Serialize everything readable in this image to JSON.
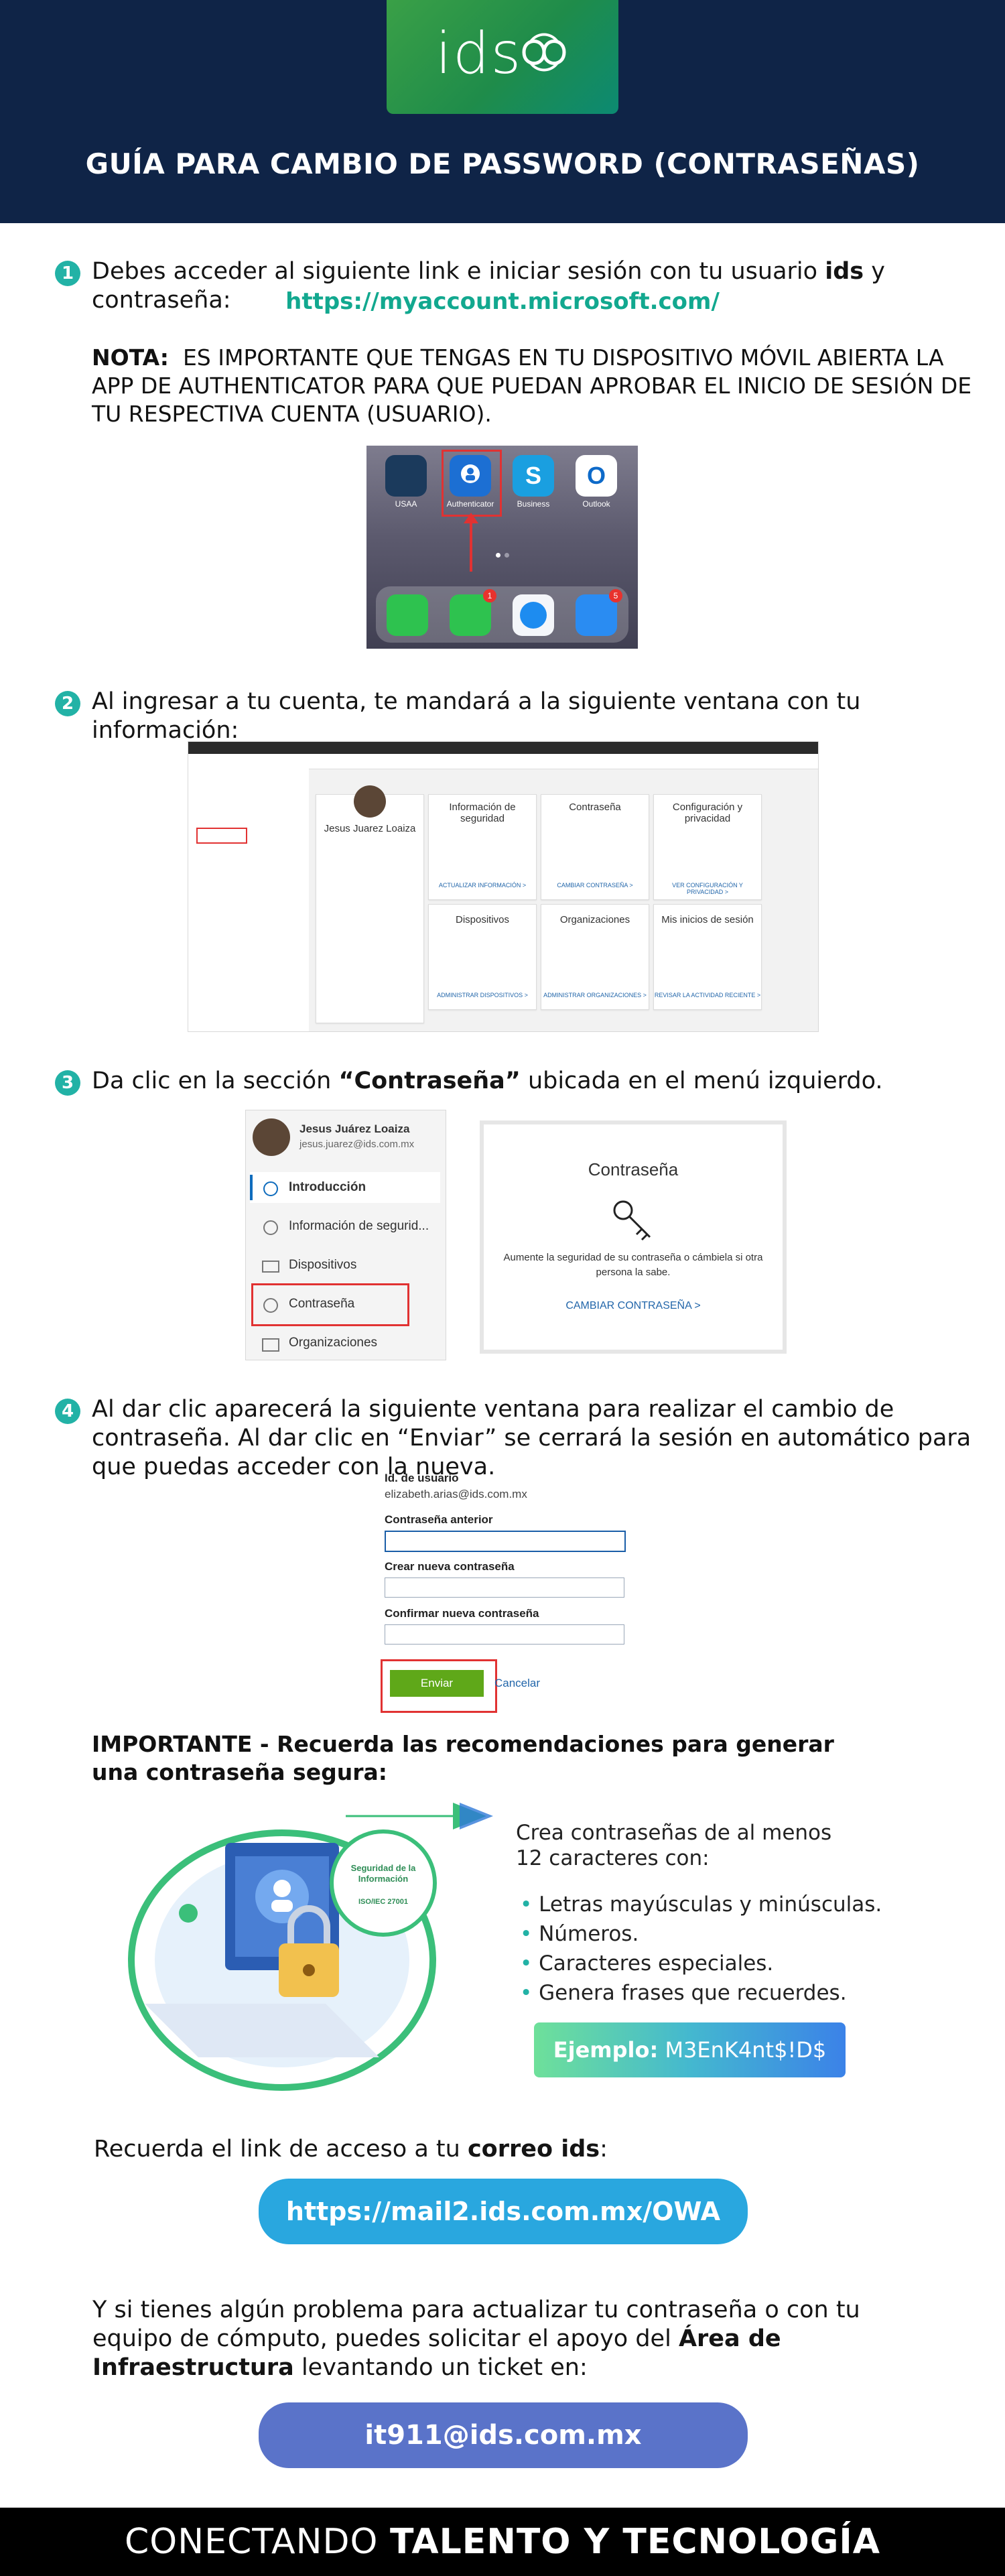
{
  "header": {
    "logo_text": "ids",
    "title": "GUÍA PARA CAMBIO DE PASSWORD (CONTRASEÑAS)"
  },
  "step1": {
    "number": "1",
    "text_a": "Debes acceder al siguiente link e iniciar sesión con tu usuario ",
    "text_bold": "ids",
    "text_b": " y contraseña:",
    "link": "https://myaccount.microsoft.com/",
    "note_label": "NOTA:",
    "note_text": "ES IMPORTANTE QUE TENGAS EN TU DISPOSITIVO MÓVIL ABIERTA LA APP DE AUTHENTICATOR PARA QUE PUEDAN APROBAR EL INICIO DE SESIÓN DE TU RESPECTIVA CUENTA (USUARIO).",
    "apps": [
      "USAA",
      "Authenticator",
      "Business",
      "Outlook"
    ],
    "badge_messages": "1",
    "badge_mail": "5"
  },
  "step2": {
    "number": "2",
    "text": "Al ingresar a tu cuenta, te mandará a la siguiente ventana con tu información:",
    "user_name": "Jesus Juarez Loaiza",
    "tiles": [
      {
        "title": "Información de seguridad",
        "link": "ACTUALIZAR INFORMACIÓN >"
      },
      {
        "title": "Contraseña",
        "link": "CAMBIAR CONTRASEÑA >"
      },
      {
        "title": "Configuración y privacidad",
        "link": "VER CONFIGURACIÓN Y PRIVACIDAD >"
      },
      {
        "title": "Dispositivos",
        "link": "ADMINISTRAR DISPOSITIVOS >"
      },
      {
        "title": "Organizaciones",
        "link": "ADMINISTRAR ORGANIZACIONES >"
      },
      {
        "title": "Mis inicios de sesión",
        "link": "REVISAR LA ACTIVIDAD RECIENTE >"
      }
    ]
  },
  "step3": {
    "number": "3",
    "text_a": "Da clic en la sección ",
    "text_bold": "“Contraseña”",
    "text_b": " ubicada en el menú izquierdo.",
    "user_name": "Jesus Juárez Loaiza",
    "user_email": "jesus.juarez@ids.com.mx",
    "menu": [
      "Introducción",
      "Información de segurid...",
      "Dispositivos",
      "Contraseña",
      "Organizaciones"
    ],
    "card_title": "Contraseña",
    "card_desc": "Aumente la seguridad de su contraseña o cámbiela si otra persona la sabe.",
    "card_link": "CAMBIAR CONTRASEÑA  >"
  },
  "step4": {
    "number": "4",
    "text": "Al dar clic aparecerá la siguiente ventana para realizar el cambio de contraseña. Al dar clic en “Enviar” se cerrará la sesión en automático para que puedas acceder con la nueva.",
    "user_id_label": "Id. de usuario",
    "user_id_value": "elizabeth.arias@ids.com.mx",
    "field_old": "Contraseña anterior",
    "field_new": "Crear nueva contraseña",
    "field_confirm": "Confirmar nueva contraseña",
    "submit": "Enviar",
    "cancel": "Cancelar"
  },
  "important": {
    "label": "IMPORTANTE -",
    "text": " Recuerda las recomendaciones para generar una contraseña segura:",
    "intro": "Crea contraseñas de al menos 12 caracteres con:",
    "bullets": [
      "Letras mayúsculas y minúsculas.",
      "Números.",
      "Caracteres especiales.",
      "Genera frases que recuerdes."
    ],
    "example_label": "Ejemplo:",
    "example_value": "M3EnK4nt$!D$",
    "seal_text": "Seguridad de la Información",
    "seal_iso": "ISO/IEC 27001"
  },
  "mail": {
    "text_a": "Recuerda el link de acceso a tu ",
    "text_bold": "correo ids",
    "text_b": ":",
    "link": "https://mail2.ids.com.mx/OWA"
  },
  "support": {
    "text_a": "Y si tienes algún problema para actualizar tu contraseña o con tu equipo de cómputo, puedes solicitar el apoyo del ",
    "text_bold": "Área de Infraestructura",
    "text_b": " levantando un ticket en:",
    "email": "it911@ids.com.mx"
  },
  "footer": {
    "text_a": "CONECTANDO ",
    "text_bold": "TALENTO Y TECNOLOGÍA"
  },
  "colors": {
    "header_bg": "#0f2447",
    "accent_teal": "#22b2a6",
    "link_green": "#12a88f",
    "mail_pill": "#29a7df",
    "support_pill": "#5a73c9",
    "example_pill": "#3b82e8"
  }
}
